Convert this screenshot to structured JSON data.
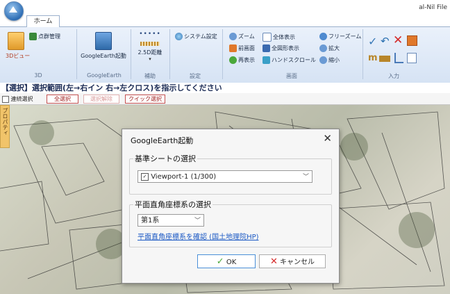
{
  "app": {
    "title_partial": "al-Nil File"
  },
  "ribbon": {
    "tab_home": "ホーム",
    "groups": {
      "g3d": {
        "label": "3D",
        "btn_3dview": "3Dビュー",
        "btn_pointcloud": "点群管理"
      },
      "gearth": {
        "label": "GoogleEarth",
        "btn_launch": "GoogleEarth起動"
      },
      "aux": {
        "label": "補助",
        "btn_25d": "2.5D距離"
      },
      "settings": {
        "label": "設定",
        "btn_system": "システム設定"
      },
      "view": {
        "label": "画面",
        "btn_zoom": "ズーム",
        "btn_all": "全体表示",
        "btn_freezoom": "フリーズーム",
        "btn_prev": "前画面",
        "btn_allfig": "全図形表示",
        "btn_zoomin": "拡大",
        "btn_redraw": "再表示",
        "btn_handscroll": "ハンドスクロール",
        "btn_zoomout": "縮小"
      },
      "input": {
        "label": "入力"
      }
    }
  },
  "instruction": "【選択】選択範囲(左→右イン 右→左クロス)を指示してください",
  "selbar": {
    "continuous": "連続選択",
    "all_select": "全選択",
    "all_deselect": "選択解除",
    "quick_select": "クイック選択"
  },
  "sidebar": {
    "label": "プロパティ"
  },
  "dialog": {
    "title": "GoogleEarth起動",
    "close_glyph": "✕",
    "base_sheet": {
      "legend": "基準シートの選択",
      "value": "Viewport-1 (1/300)"
    },
    "coord": {
      "legend": "平面直角座標系の選択",
      "value": "第1系",
      "link": "平面直角座標系を確認 (国土地理院HP)"
    },
    "ok_label": "OK",
    "cancel_label": "キャンセル"
  },
  "colors": {
    "ribbon_top": "#eaf1fb",
    "ribbon_bottom": "#d6e3f4",
    "instruction_text": "#1b2b55",
    "link": "#1a58c4",
    "ok_check": "#4aa83a",
    "cancel_x": "#d42a2a"
  }
}
